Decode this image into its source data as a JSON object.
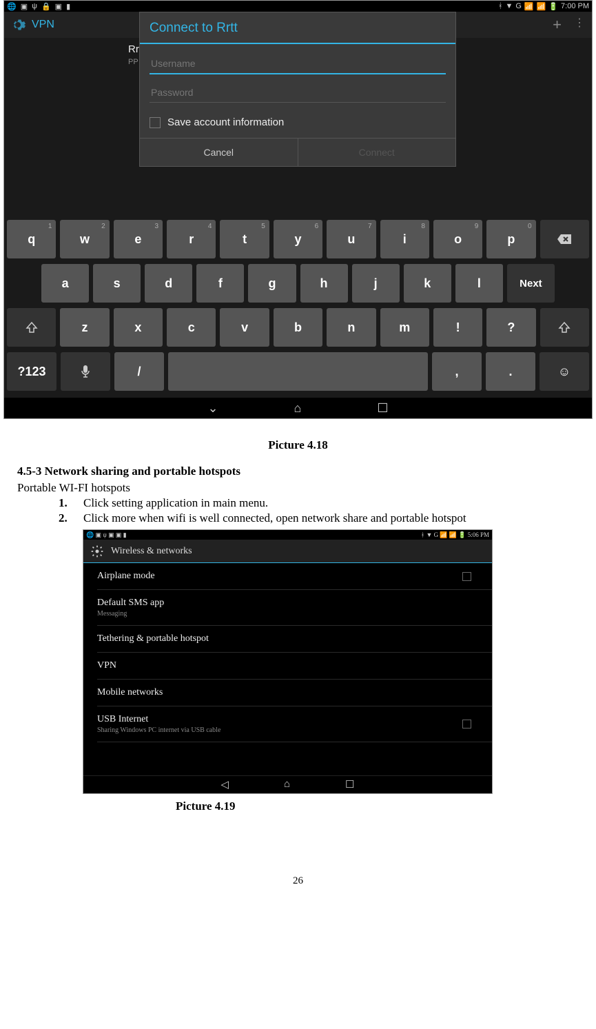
{
  "screenshot1": {
    "statusbar": {
      "time": "7:00 PM",
      "network": "G"
    },
    "vpn_header": {
      "title": "VPN"
    },
    "vpn_item": {
      "name": "Rr",
      "type": "PP"
    },
    "dialog": {
      "title": "Connect to Rrtt",
      "username_placeholder": "Username",
      "password_placeholder": "Password",
      "checkbox_label": "Save account information",
      "cancel": "Cancel",
      "connect": "Connect"
    },
    "keyboard": {
      "row1": [
        {
          "k": "q",
          "n": "1"
        },
        {
          "k": "w",
          "n": "2"
        },
        {
          "k": "e",
          "n": "3"
        },
        {
          "k": "r",
          "n": "4"
        },
        {
          "k": "t",
          "n": "5"
        },
        {
          "k": "y",
          "n": "6"
        },
        {
          "k": "u",
          "n": "7"
        },
        {
          "k": "i",
          "n": "8"
        },
        {
          "k": "o",
          "n": "9"
        },
        {
          "k": "p",
          "n": "0"
        }
      ],
      "row2": [
        "a",
        "s",
        "d",
        "f",
        "g",
        "h",
        "j",
        "k",
        "l"
      ],
      "next": "Next",
      "row3": [
        "z",
        "x",
        "c",
        "v",
        "b",
        "n",
        "m",
        "!",
        "?"
      ],
      "row4": {
        "sym": "?123",
        "slash": "/",
        "comma": ",",
        "period": "."
      }
    }
  },
  "caption1": "Picture 4.18",
  "section_heading": "4.5-3 Network sharing and portable hotspots",
  "subheading": "Portable WI-FI hotspots",
  "list": [
    "Click setting application in main menu.",
    "Click more when wifi is well connected, open network share and portable hotspot"
  ],
  "screenshot2": {
    "statusbar": {
      "time": "5:06 PM",
      "network": "G"
    },
    "header": "Wireless & networks",
    "items": [
      {
        "label": "Airplane mode",
        "checkbox": true
      },
      {
        "label": "Default SMS app",
        "sub": "Messaging"
      },
      {
        "label": "Tethering & portable hotspot"
      },
      {
        "label": "VPN"
      },
      {
        "label": "Mobile networks"
      },
      {
        "label": "USB Internet",
        "sub": "Sharing Windows PC internet via USB cable",
        "checkbox": true
      }
    ]
  },
  "caption2": "Picture 4.19",
  "page_number": "26"
}
